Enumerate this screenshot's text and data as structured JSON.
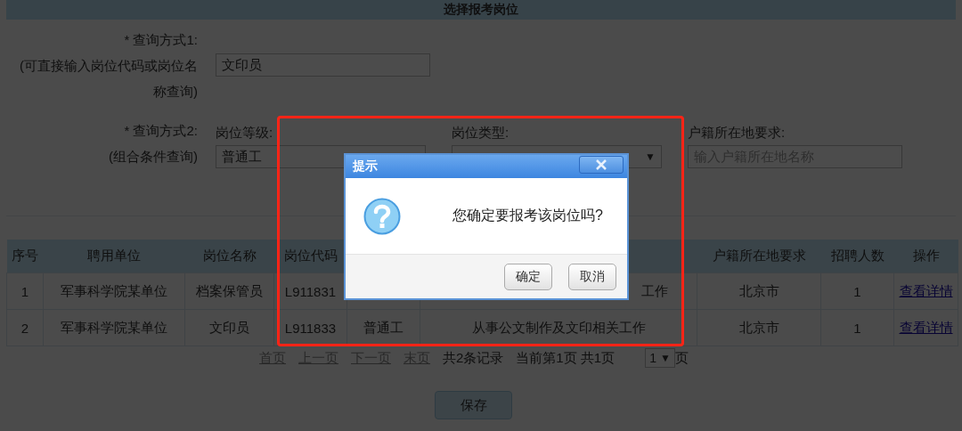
{
  "page_title": "选择报考岗位",
  "query1": {
    "label": "* 查询方式1:",
    "hint": "(可直接输入岗位代码或岗位名称查询)",
    "value": "文印员"
  },
  "query2": {
    "label": "* 查询方式2:",
    "hint": "(组合条件查询)",
    "fields": [
      {
        "kind": "select",
        "label": "岗位等级:",
        "value": "普通工"
      },
      {
        "kind": "select",
        "label": "岗位类型:",
        "arrow": "▼"
      },
      {
        "kind": "input",
        "label": "户籍所在地要求:",
        "placeholder": "输入户籍所在地名称"
      }
    ]
  },
  "table": {
    "columns": [
      {
        "heading": "序号"
      },
      {
        "heading": "聘用单位"
      },
      {
        "heading": "岗位名称"
      },
      {
        "heading": "岗位代码"
      },
      {},
      {},
      {
        "heading": "户籍所在地要求"
      },
      {
        "heading": "招聘人数"
      },
      {
        "heading": "操作"
      }
    ],
    "rows": [
      {
        "cells": [
          {
            "text": "1"
          },
          {
            "text": "军事科学院某单位"
          },
          {
            "text": "档案保管员"
          },
          {
            "text": "L911831"
          },
          {},
          {
            "text": "工作",
            "kind": "clipped"
          },
          {
            "text": "北京市"
          },
          {
            "text": "1"
          },
          {
            "text": "查看详情",
            "kind": "link"
          }
        ]
      },
      {
        "cells": [
          {
            "text": "2"
          },
          {
            "text": "军事科学院某单位"
          },
          {
            "text": "文印员"
          },
          {
            "text": "L911833"
          },
          {
            "text": "普通工"
          },
          {
            "text": "从事公文制作及文印相关工作"
          },
          {
            "text": "北京市"
          },
          {
            "text": "1"
          },
          {
            "text": "查看详情",
            "kind": "link"
          }
        ]
      }
    ]
  },
  "pagination": {
    "links": [
      "首页",
      "上一页",
      "下一页",
      "末页"
    ],
    "records": "共2条记录",
    "pages": "当前第1页 共1页",
    "page_select": "1",
    "arrow": "▼",
    "suffix": "页"
  },
  "save_button": "保存",
  "dialog": {
    "title": "提示",
    "message": "您确定要报考该岗位吗?",
    "buttons": [
      "确定",
      "取消"
    ]
  }
}
